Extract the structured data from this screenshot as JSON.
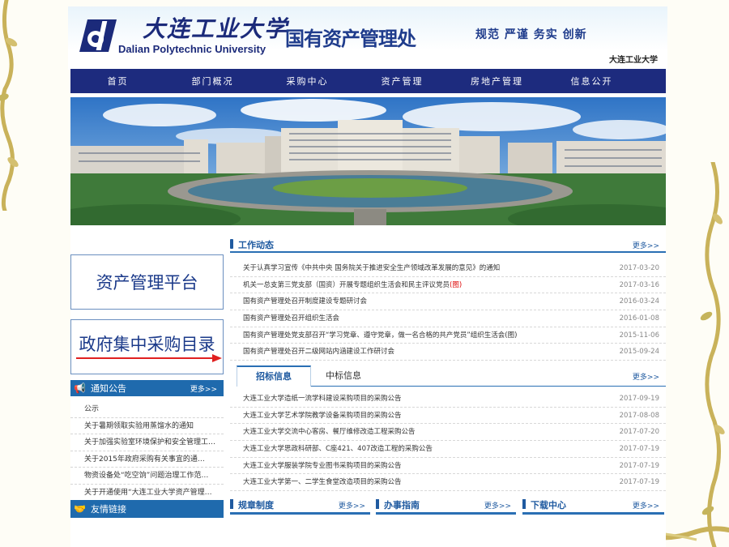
{
  "header": {
    "logo_cn": "大连工业大学",
    "logo_en": "Dalian Polytechnic University",
    "office": "国有资产管理处",
    "motto": "规范  严谨  务实  创新",
    "uni_small": "大连工业大学"
  },
  "nav": [
    "首页",
    "部门概况",
    "采购中心",
    "资产管理",
    "房地产管理",
    "信息公开"
  ],
  "sidebar": {
    "asset_platform": "资产管理平台",
    "procurement_catalog": "政府集中采购目录",
    "notice_title": "通知公告",
    "notice_more": "更多>>",
    "notices": [
      "公示",
      "关于暑期领取实验用蒸馏水的通知",
      "关于加强实验室环境保护和安全管理工…",
      "关于2015年政府采购有关事宜的通…",
      "物资设备处“吃空饷”问题治理工作范…",
      "关于开通使用“大连工业大学资产管理…"
    ],
    "links_title": "友情链接"
  },
  "work": {
    "title": "工作动态",
    "more": "更多>>",
    "items": [
      {
        "text": "关于认真学习宣传《中共中央 国务院关于推进安全生产领域改革发展的意见》的通知",
        "date": "2017-03-20",
        "tag": ""
      },
      {
        "text": "机关一总支第三党支部（国资）开展专题组织生活会和民主评议党员",
        "date": "2017-03-16",
        "tag": "(图)"
      },
      {
        "text": "国有资产管理处召开制度建设专题研讨会",
        "date": "2016-03-24",
        "tag": ""
      },
      {
        "text": "国有资产管理处召开组织生活会",
        "date": "2016-01-08",
        "tag": ""
      },
      {
        "text": "国有资产管理处党支部召开“学习党章、遵守党章，做一名合格的共产党员”组织生活会(图)",
        "date": "2015-11-06",
        "tag": ""
      },
      {
        "text": "国有资产管理处召开二级网站内涵建设工作研讨会",
        "date": "2015-09-24",
        "tag": ""
      }
    ]
  },
  "tender": {
    "tab1": "招标信息",
    "tab2": "中标信息",
    "more": "更多>>",
    "items": [
      {
        "text": "大连工业大学造纸一流学科建设采购项目的采购公告",
        "date": "2017-09-19"
      },
      {
        "text": "大连工业大学艺术学院教学设备采购项目的采购公告",
        "date": "2017-08-08"
      },
      {
        "text": "大连工业大学交流中心客房、餐厅维修改造工程采购公告",
        "date": "2017-07-20"
      },
      {
        "text": "大连工业大学思政科研部、C座421、407改造工程的采购公告",
        "date": "2017-07-19"
      },
      {
        "text": "大连工业大学服装学院专业图书采购项目的采购公告",
        "date": "2017-07-19"
      },
      {
        "text": "大连工业大学第一、二学生食堂改造项目的采购公告",
        "date": "2017-07-19"
      }
    ]
  },
  "bottom": {
    "rules": "规章制度",
    "guide": "办事指南",
    "download": "下载中心",
    "more": "更多>>"
  },
  "colors": {
    "nav": "#1d2b7e",
    "accent": "#2a6fb4",
    "title": "#1f3c8c"
  }
}
